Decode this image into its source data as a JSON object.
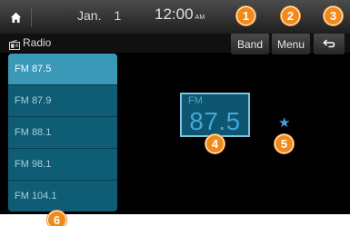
{
  "status_bar": {
    "date_month": "Jan.",
    "date_day": "1",
    "time": "12:00",
    "ampm": "AM"
  },
  "title_bar": {
    "title": "Radio",
    "band_label": "Band",
    "menu_label": "Menu",
    "back_icon": "back-arrow-icon"
  },
  "preset_list": [
    {
      "label": "FM 87.5",
      "selected": true
    },
    {
      "label": "FM 87.9",
      "selected": false
    },
    {
      "label": "FM 88.1",
      "selected": false
    },
    {
      "label": "FM 98.1",
      "selected": false
    },
    {
      "label": "FM 104.1",
      "selected": false
    }
  ],
  "now_playing": {
    "band": "FM",
    "frequency": "87.5",
    "favorite": true
  },
  "callouts": [
    "1",
    "2",
    "3",
    "4",
    "5",
    "6"
  ],
  "colors": {
    "callout": "#f08a1c",
    "list_background": "#0f5d74",
    "list_selected": "#3a99b7",
    "frequency_text": "#3fa8d8"
  }
}
